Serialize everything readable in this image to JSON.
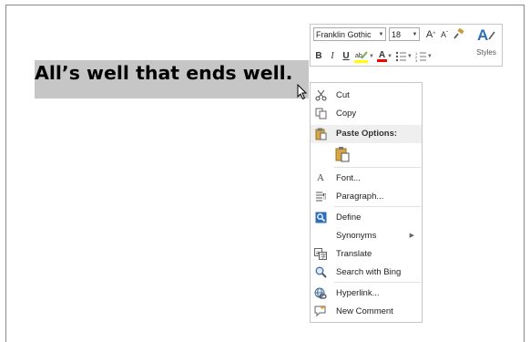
{
  "document": {
    "text": "All’s well that ends well."
  },
  "mini_toolbar": {
    "font_name": "Franklin Gothic",
    "font_size": "18",
    "grow_font": "A",
    "shrink_font": "A",
    "bold": "B",
    "italic": "I",
    "underline": "U",
    "font_color": "A",
    "styles_label": "Styles",
    "highlight_color": "#ffff00",
    "font_color_bar": "#ff0000"
  },
  "context_menu": {
    "items": [
      {
        "label": "Cut",
        "icon": "scissors-icon"
      },
      {
        "label": "Copy",
        "icon": "copy-icon"
      },
      {
        "label": "Paste Options:",
        "icon": "paste-icon"
      },
      {
        "label": "Font...",
        "icon": "font-icon"
      },
      {
        "label": "Paragraph...",
        "icon": "paragraph-icon"
      },
      {
        "label": "Define",
        "icon": "define-icon"
      },
      {
        "label": "Synonyms",
        "icon": ""
      },
      {
        "label": "Translate",
        "icon": "translate-icon"
      },
      {
        "label": "Search with Bing",
        "icon": "search-icon"
      },
      {
        "label": "Hyperlink...",
        "icon": "hyperlink-icon"
      },
      {
        "label": "New Comment",
        "icon": "comment-icon"
      }
    ]
  }
}
